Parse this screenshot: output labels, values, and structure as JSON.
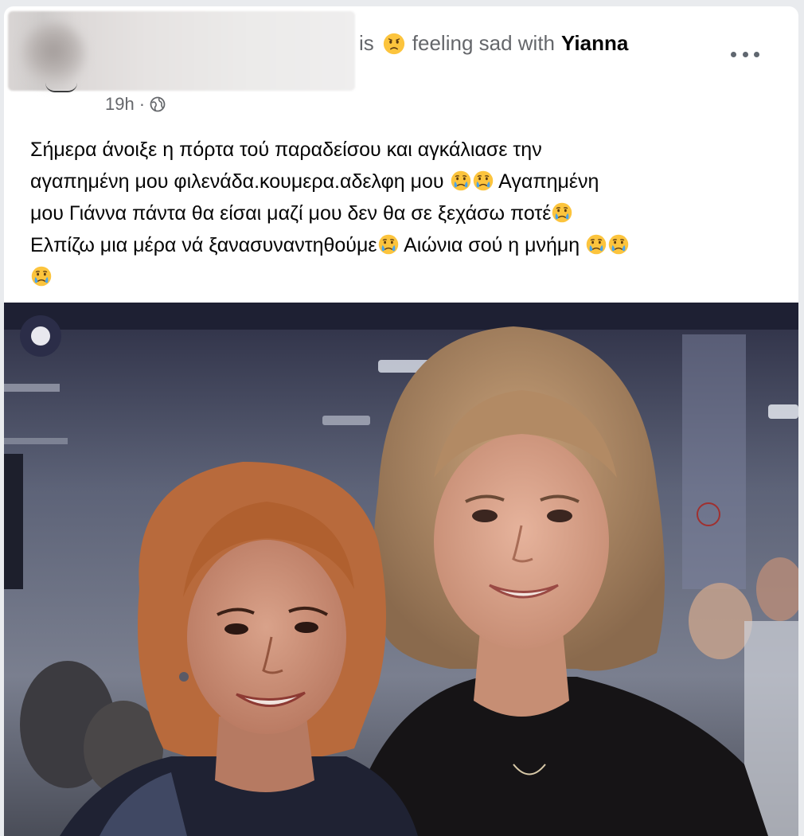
{
  "post": {
    "author_action_is": "is",
    "feeling_text": "feeling sad with",
    "tagged_name": "Yianna",
    "timestamp": "19h",
    "separator": "·",
    "text_lines": [
      "Σήμερα άνοιξε η πόρτα τού παραδείσου και αγκάλιασε την",
      "αγαπημένη μου φιλενάδα.κουμερα.αδελφη μου",
      "Αγαπημένη",
      "μου Γιάννα πάντα θα είσαι μαζί μου δεν θα σε ξεχάσω ποτέ",
      "Ελπίζω μια μέρα νά ξανασυναντηθούμε",
      "Αιώνια σού η μνήμη"
    ]
  },
  "icons": {
    "feeling": "sad-face-icon",
    "privacy": "globe-icon",
    "menu": "more-options-icon",
    "emoji": "crying-face-icon"
  },
  "colors": {
    "secondary_text": "#65676b",
    "primary_text": "#050505",
    "emoji_yellow": "#fcc43d",
    "tear_blue": "#4aa3e8"
  }
}
